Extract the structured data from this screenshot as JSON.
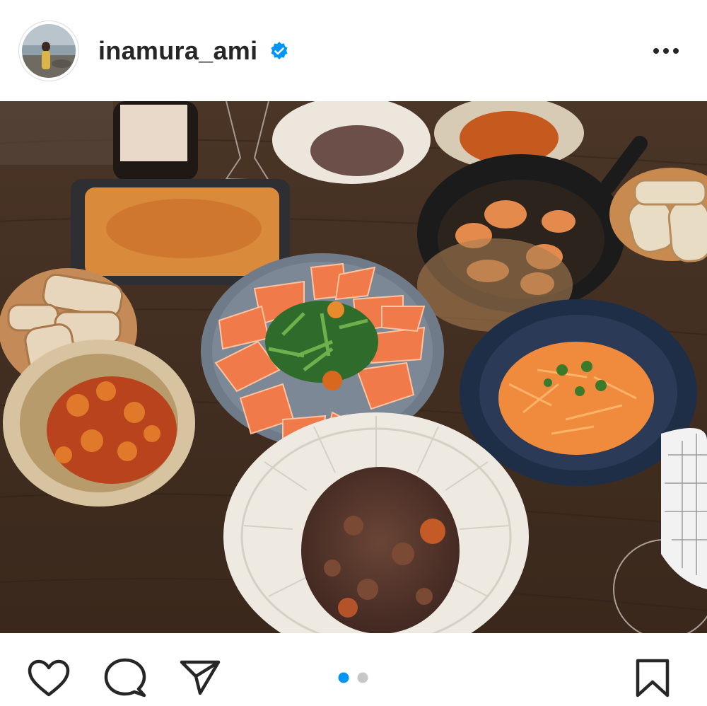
{
  "post": {
    "username": "inamura_ami",
    "verified": true,
    "verified_icon": "verified-badge-icon",
    "more_icon": "more-options-icon",
    "avatar_alt": "profile-avatar"
  },
  "media": {
    "type": "photo",
    "carousel_count": 2,
    "active_index": 0
  },
  "actions": {
    "like_icon": "heart-icon",
    "comment_icon": "comment-icon",
    "share_icon": "send-icon",
    "save_icon": "bookmark-icon"
  },
  "colors": {
    "text": "#262626",
    "verified_blue": "#0095f6",
    "carousel_active": "#0095f6",
    "carousel_inactive": "#c7c7c7"
  }
}
